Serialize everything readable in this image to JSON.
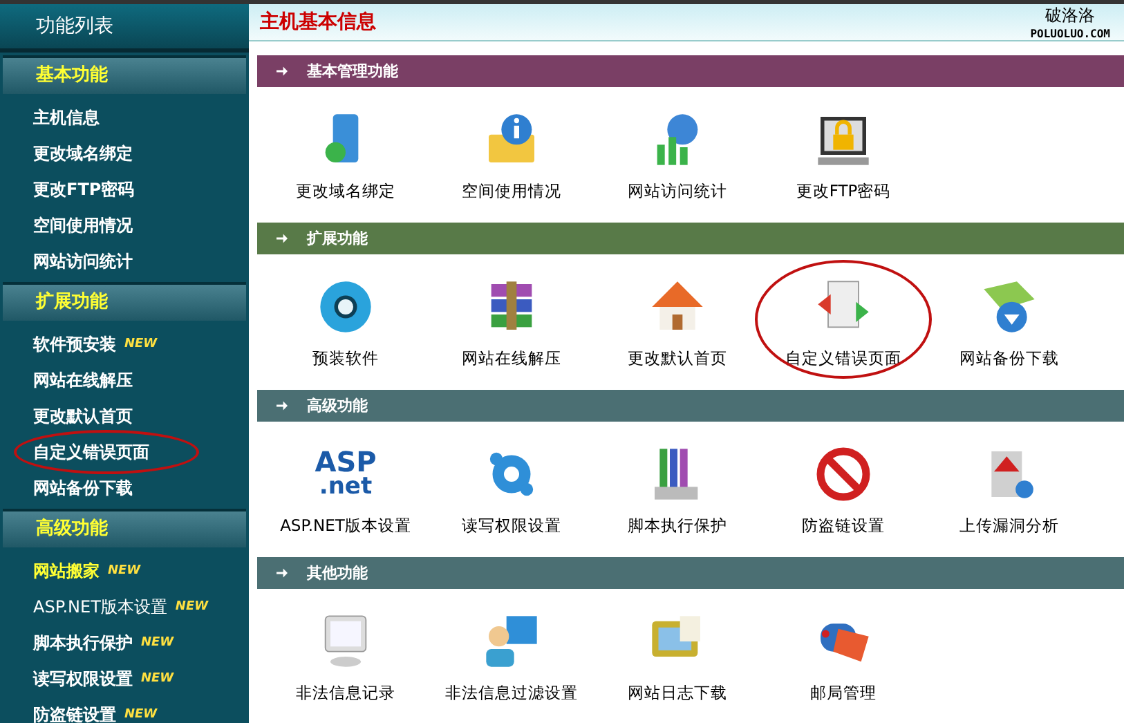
{
  "sidebar": {
    "title": "功能列表",
    "sections": [
      {
        "title": "基本功能",
        "items": [
          {
            "label": "主机信息",
            "bold": true,
            "highlighted": false,
            "circled": false
          },
          {
            "label": "更改域名绑定",
            "bold": true,
            "highlighted": false,
            "circled": false
          },
          {
            "label": "更改FTP密码",
            "bold": true,
            "highlighted": false,
            "circled": false
          },
          {
            "label": "空间使用情况",
            "bold": true,
            "highlighted": false,
            "circled": false
          },
          {
            "label": "网站访问统计",
            "bold": true,
            "highlighted": false,
            "circled": false
          }
        ]
      },
      {
        "title": "扩展功能",
        "items": [
          {
            "label": "软件预安装",
            "bold": true,
            "highlighted": false,
            "badge": "NEW",
            "circled": false
          },
          {
            "label": "网站在线解压",
            "bold": true,
            "highlighted": false,
            "circled": false
          },
          {
            "label": "更改默认首页",
            "bold": true,
            "highlighted": false,
            "circled": false
          },
          {
            "label": "自定义错误页面",
            "bold": true,
            "highlighted": false,
            "circled": true
          },
          {
            "label": "网站备份下载",
            "bold": true,
            "highlighted": false,
            "circled": false
          }
        ]
      },
      {
        "title": "高级功能",
        "items": [
          {
            "label": "网站搬家",
            "bold": true,
            "highlighted": true,
            "badge": "NEW",
            "circled": false
          },
          {
            "label": "ASP.NET版本设置",
            "bold": false,
            "highlighted": false,
            "badge": "NEW",
            "circled": false
          },
          {
            "label": "脚本执行保护",
            "bold": true,
            "highlighted": false,
            "badge": "NEW",
            "circled": false
          },
          {
            "label": "读写权限设置",
            "bold": true,
            "highlighted": false,
            "badge": "NEW",
            "circled": false
          },
          {
            "label": "防盗链设置",
            "bold": true,
            "highlighted": false,
            "badge": "NEW",
            "circled": false
          }
        ]
      }
    ]
  },
  "header": {
    "title": "主机基本信息",
    "logo_name": "破洛洛",
    "logo_domain": "POLUOLUO.COM"
  },
  "sections": [
    {
      "title": "基本管理功能",
      "color": "#7a3f65",
      "items": [
        {
          "label": "更改域名绑定",
          "circled": false
        },
        {
          "label": "空间使用情况",
          "circled": false
        },
        {
          "label": "网站访问统计",
          "circled": false
        },
        {
          "label": "更改FTP密码",
          "circled": false
        }
      ]
    },
    {
      "title": "扩展功能",
      "color": "#587a48",
      "items": [
        {
          "label": "预装软件",
          "circled": false
        },
        {
          "label": "网站在线解压",
          "circled": false
        },
        {
          "label": "更改默认首页",
          "circled": false
        },
        {
          "label": "自定义错误页面",
          "circled": true
        },
        {
          "label": "网站备份下载",
          "circled": false
        }
      ]
    },
    {
      "title": "高级功能",
      "color": "#4b6f73",
      "items": [
        {
          "label": "ASP.NET版本设置",
          "circled": false,
          "logo_text": [
            "ASP",
            ".net"
          ]
        },
        {
          "label": "读写权限设置",
          "circled": false
        },
        {
          "label": "脚本执行保护",
          "circled": false
        },
        {
          "label": "防盗链设置",
          "circled": false
        },
        {
          "label": "上传漏洞分析",
          "circled": false
        }
      ]
    },
    {
      "title": "其他功能",
      "color": "#4b6f73",
      "items": [
        {
          "label": "非法信息记录",
          "circled": false
        },
        {
          "label": "非法信息过滤设置",
          "circled": false
        },
        {
          "label": "网站日志下载",
          "circled": false
        },
        {
          "label": "邮局管理",
          "circled": false
        }
      ]
    }
  ]
}
